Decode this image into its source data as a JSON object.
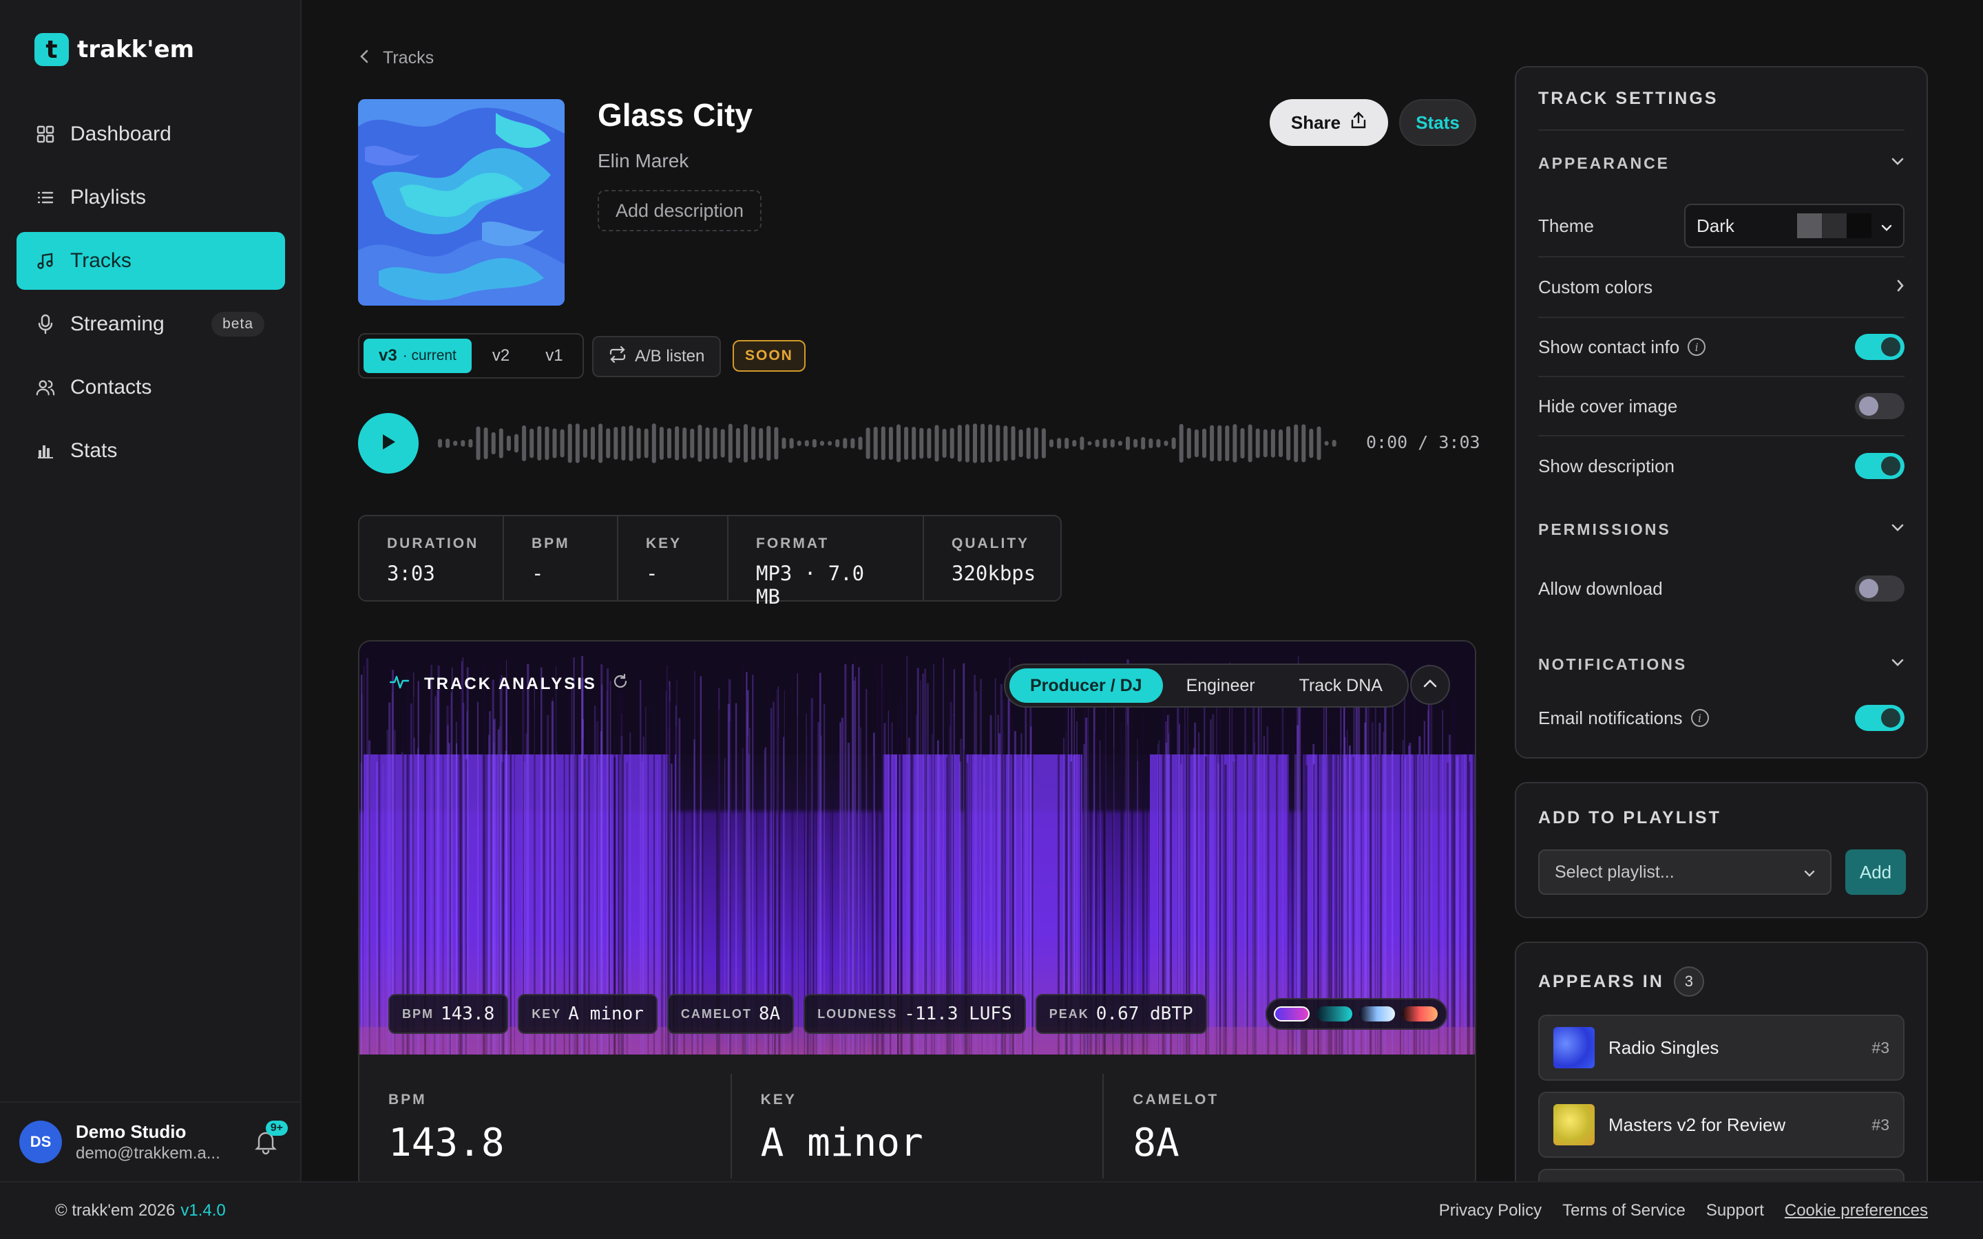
{
  "app": {
    "logo_text": "trakk'em",
    "logo_glyph": "t"
  },
  "nav": {
    "items": [
      {
        "label": "Dashboard",
        "icon": "grid-icon"
      },
      {
        "label": "Playlists",
        "icon": "list-icon"
      },
      {
        "label": "Tracks",
        "icon": "music-note-icon",
        "active": true
      },
      {
        "label": "Streaming",
        "icon": "microphone-icon",
        "badge": "beta"
      },
      {
        "label": "Contacts",
        "icon": "users-icon"
      },
      {
        "label": "Stats",
        "icon": "bar-chart-icon"
      }
    ]
  },
  "user": {
    "initials": "DS",
    "name": "Demo Studio",
    "email": "demo@trakkem.a...",
    "notif_badge": "9+"
  },
  "footer": {
    "copyright": "© trakk'em 2026",
    "version": "v1.4.0",
    "links": [
      "Privacy Policy",
      "Terms of Service",
      "Support",
      "Cookie preferences"
    ]
  },
  "breadcrumb": {
    "label": "Tracks"
  },
  "track": {
    "title": "Glass City",
    "artist": "Elin Marek",
    "add_description": "Add description",
    "share_label": "Share",
    "stats_label": "Stats",
    "versions": [
      {
        "label": "v3",
        "suffix": "· current",
        "active": true
      },
      {
        "label": "v2"
      },
      {
        "label": "v1"
      }
    ],
    "ab_label": "A/B listen",
    "soon_badge": "SOON",
    "time": "0:00 / 3:03",
    "meta": [
      {
        "label": "DURATION",
        "value": "3:03"
      },
      {
        "label": "BPM",
        "value": "-"
      },
      {
        "label": "KEY",
        "value": "-"
      },
      {
        "label": "FORMAT",
        "value": "MP3 · 7.0 MB"
      },
      {
        "label": "QUALITY",
        "value": "320kbps"
      }
    ]
  },
  "analysis": {
    "title": "TRACK ANALYSIS",
    "tabs": [
      {
        "label": "Producer / DJ",
        "active": true
      },
      {
        "label": "Engineer"
      },
      {
        "label": "Track DNA"
      }
    ],
    "pills": [
      {
        "k": "BPM",
        "v": "143.8"
      },
      {
        "k": "KEY",
        "v": "A minor"
      },
      {
        "k": "CAMELOT",
        "v": "8A"
      },
      {
        "k": "LOUDNESS",
        "v": "-11.3 LUFS"
      },
      {
        "k": "PEAK",
        "v": "0.67 dBTP"
      }
    ],
    "stats": [
      {
        "k": "BPM",
        "v": "143.8"
      },
      {
        "k": "KEY",
        "v": "A minor"
      },
      {
        "k": "CAMELOT",
        "v": "8A"
      }
    ]
  },
  "settings": {
    "title": "TRACK SETTINGS",
    "appearance": "APPEARANCE",
    "theme_label": "Theme",
    "theme_value": "Dark",
    "custom_colors": "Custom colors",
    "show_contact": "Show contact info",
    "hide_cover": "Hide cover image",
    "show_description": "Show description",
    "permissions": "PERMISSIONS",
    "allow_download": "Allow download",
    "notifications": "NOTIFICATIONS",
    "email_notifications": "Email notifications",
    "toggles": {
      "show_contact": true,
      "hide_cover": false,
      "show_description": true,
      "allow_download": false,
      "email_notifications": true
    }
  },
  "add_playlist": {
    "title": "ADD TO PLAYLIST",
    "placeholder": "Select playlist...",
    "add_label": "Add"
  },
  "appears_in": {
    "title": "APPEARS IN",
    "count": "3",
    "items": [
      {
        "name": "Radio Singles",
        "rank": "#3"
      },
      {
        "name": "Masters v2 for Review",
        "rank": "#3"
      }
    ]
  }
}
